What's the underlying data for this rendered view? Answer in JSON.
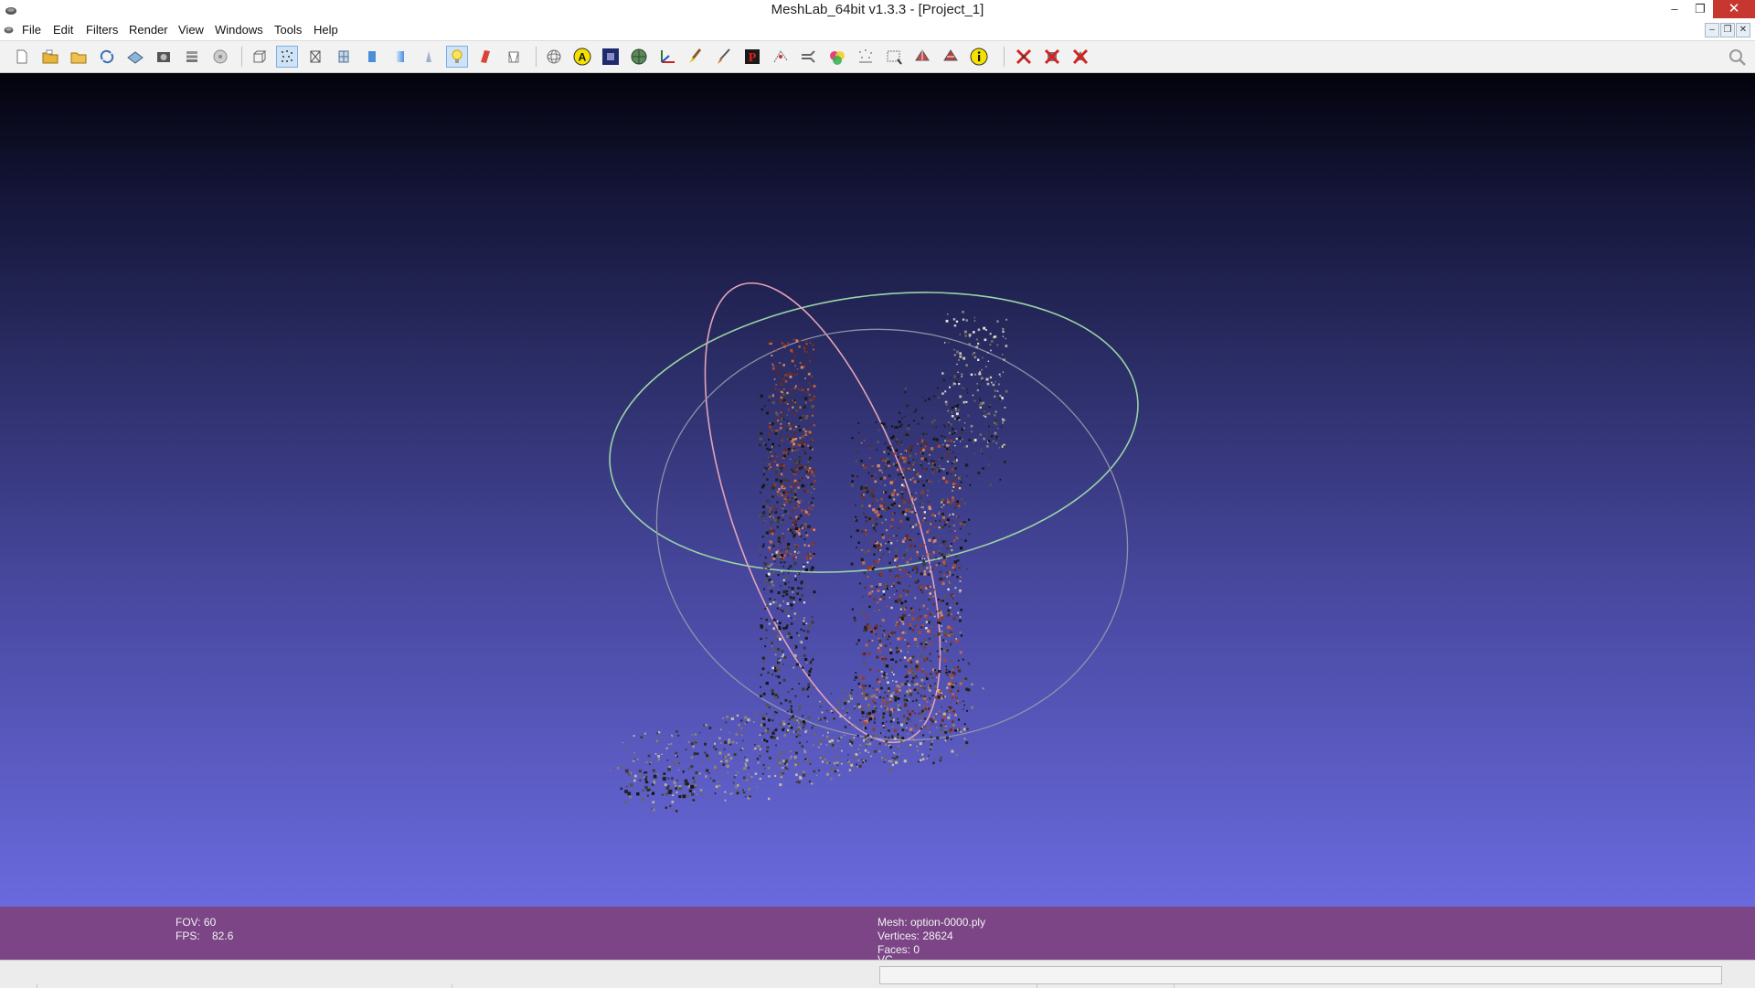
{
  "window": {
    "title": "MeshLab_64bit v1.3.3 - [Project_1]",
    "minimize_label": "–",
    "maximize_label": "❐",
    "close_label": "✕"
  },
  "menu": {
    "items": [
      "File",
      "Edit",
      "Filters",
      "Render",
      "View",
      "Windows",
      "Tools",
      "Help"
    ]
  },
  "mdi": {
    "minimize_label": "–",
    "restore_label": "❐",
    "close_label": "✕"
  },
  "toolbar": {
    "groups": [
      [
        "new-project-icon",
        "open-project-icon",
        "import-mesh-icon",
        "reload-icon",
        "save-icon",
        "snapshot-icon",
        "layers-icon",
        "disk-icon"
      ],
      [
        "bounding-box-icon",
        "points-render-icon",
        "wireframe-icon",
        "hidden-lines-icon",
        "flat-render-icon",
        "smooth-render-icon",
        "texture-render-icon",
        "light-bulb-icon",
        "back-face-icon",
        "fancy-light-icon"
      ],
      [
        "trackball-icon",
        "annotation-icon",
        "raster-layer-icon",
        "sphere-icon",
        "axes-icon",
        "paint-brush-icon",
        "paint-icon",
        "select-vertices-icon",
        "measure-icon",
        "align-icon",
        "color-icon",
        "reference-icon",
        "select-faces-icon",
        "edit-pick-icon",
        "edit-manipulator-icon",
        "info-icon"
      ],
      [
        "delete-vertices-icon",
        "delete-faces-icon",
        "delete-faces-vertices-icon"
      ]
    ],
    "search_icon": "search-icon"
  },
  "viewport": {
    "gradient_top": "#03030c",
    "gradient_bottom": "#6a6ade"
  },
  "info": {
    "fov": "FOV: 60",
    "fps": "FPS:    82.6",
    "mesh": "Mesh: option-0000.ply",
    "vertices": "Vertices: 28624",
    "faces": "Faces: 0",
    "vc": "VC"
  },
  "colors": {
    "infobar_bg": "#7b4586",
    "close_button": "#c7372f",
    "trackball_green": "#9ad3a6",
    "trackball_pink": "#e3a3b8",
    "trackball_gray": "#9a9aae"
  }
}
